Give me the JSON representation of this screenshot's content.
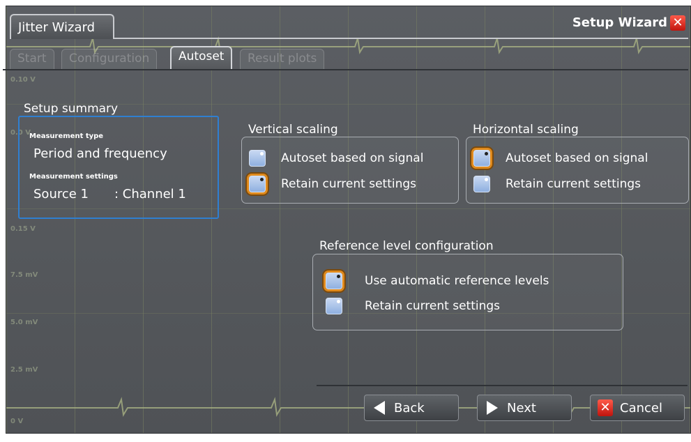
{
  "window": {
    "tab_title": "Jitter Wizard",
    "wizard_title": "Setup Wizard",
    "close_icon": "close-icon"
  },
  "steps": [
    {
      "label": "Start",
      "active": false
    },
    {
      "label": "Configuration",
      "active": false
    },
    {
      "label": "Autoset",
      "active": true
    },
    {
      "label": "Result plots",
      "active": false
    }
  ],
  "background_labels": [
    "0.10 V",
    "0.0 V",
    "0.15 V",
    "7.5 mV",
    "5.0 mV",
    "2.5 mV",
    "0 V"
  ],
  "summary": {
    "heading": "Setup summary",
    "measurement_type_label": "Measurement type",
    "measurement_type_value": "Period and frequency",
    "measurement_settings_label": "Measurement settings",
    "source_label": "Source 1",
    "source_value": ": Channel 1"
  },
  "vertical_scaling": {
    "title": "Vertical scaling",
    "options": [
      {
        "label": "Autoset based on signal",
        "selected": false
      },
      {
        "label": "Retain current settings",
        "selected": true
      }
    ]
  },
  "horizontal_scaling": {
    "title": "Horizontal scaling",
    "options": [
      {
        "label": "Autoset based on signal",
        "selected": true
      },
      {
        "label": "Retain current settings",
        "selected": false
      }
    ]
  },
  "reference_level": {
    "title": "Reference level configuration",
    "options": [
      {
        "label": "Use automatic reference levels",
        "selected": true
      },
      {
        "label": "Retain current settings",
        "selected": false
      }
    ]
  },
  "buttons": {
    "back": "Back",
    "next": "Next",
    "cancel": "Cancel"
  },
  "colors": {
    "accent_selected": "#e08a1c",
    "summary_border": "#2f7fd1",
    "close_red": "#d3241b",
    "trace": "#aeb786"
  }
}
